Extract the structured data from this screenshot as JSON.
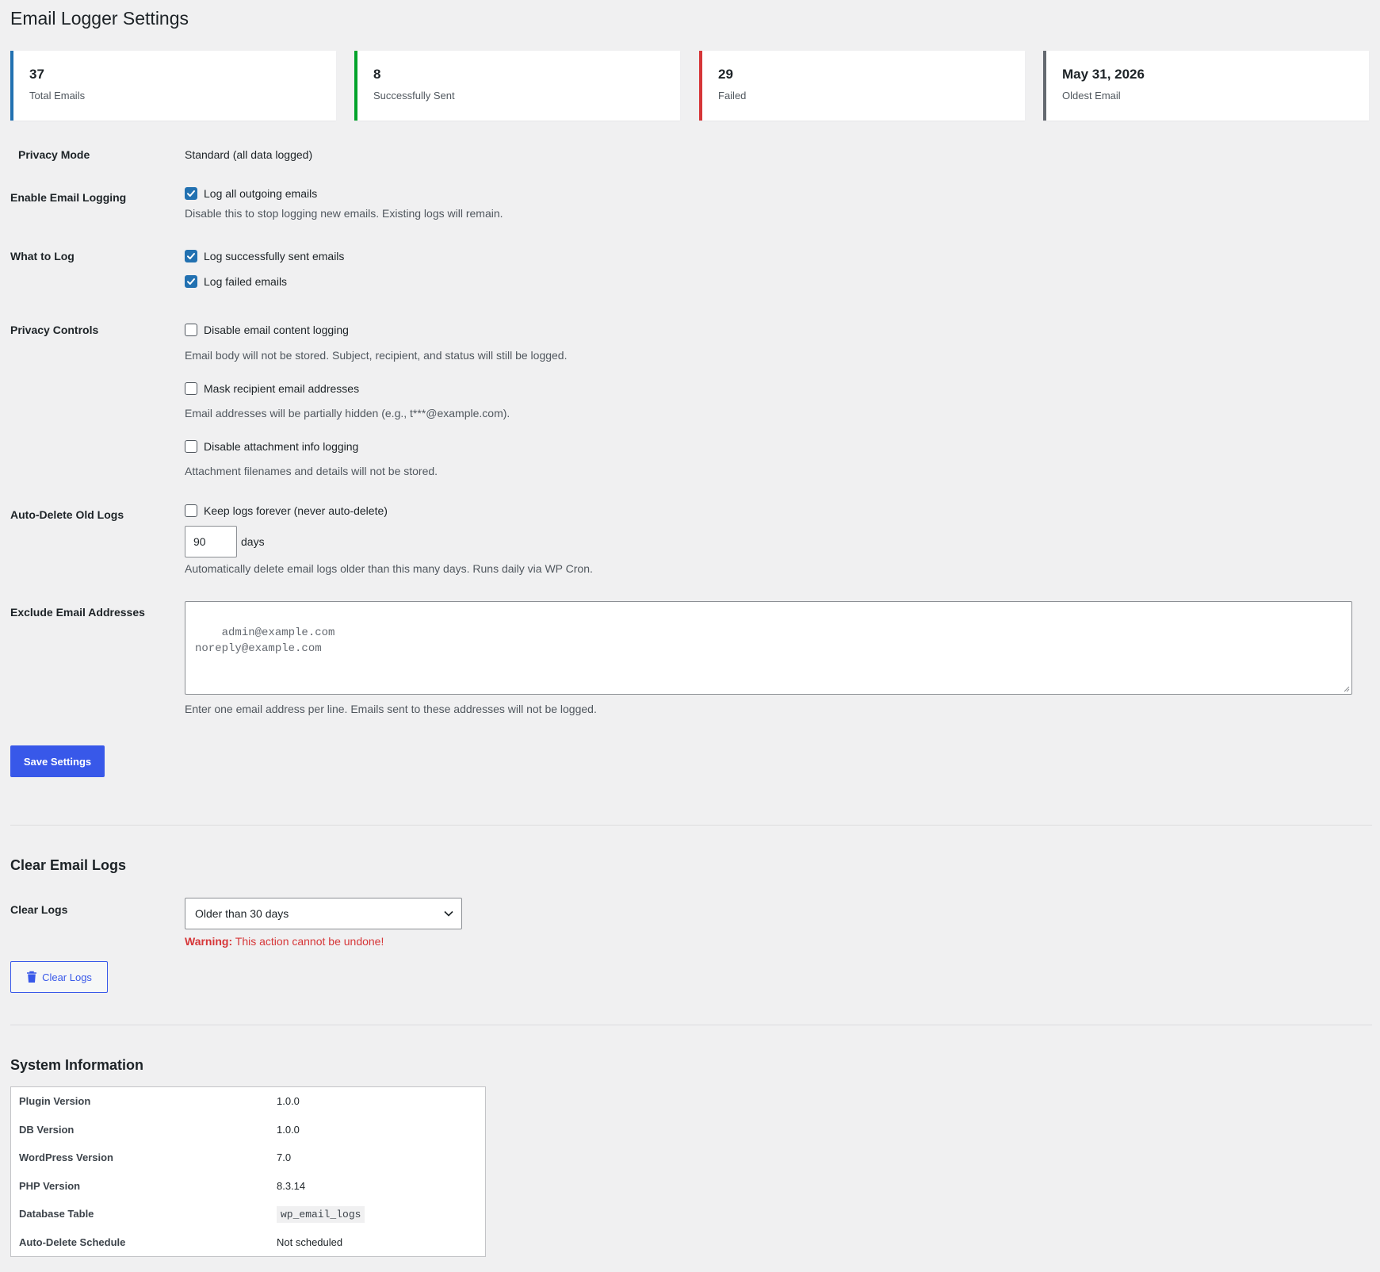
{
  "page": {
    "title": "Email Logger Settings"
  },
  "stats": [
    {
      "value": "37",
      "label": "Total Emails",
      "color": "#2271b1"
    },
    {
      "value": "8",
      "label": "Successfully Sent",
      "color": "#00a32a"
    },
    {
      "value": "29",
      "label": "Failed",
      "color": "#d63638"
    },
    {
      "value": "May 31, 2026",
      "label": "Oldest Email",
      "color": "#646970"
    }
  ],
  "settings": {
    "privacy_mode": {
      "label": "Privacy Mode",
      "value": "Standard (all data logged)"
    },
    "enable_logging": {
      "label": "Enable Email Logging",
      "checkbox_label": "Log all outgoing emails",
      "checked": true,
      "description": "Disable this to stop logging new emails. Existing logs will remain."
    },
    "what_to_log": {
      "label": "What to Log",
      "options": [
        {
          "label": "Log successfully sent emails",
          "checked": true
        },
        {
          "label": "Log failed emails",
          "checked": true
        }
      ]
    },
    "privacy_controls": {
      "label": "Privacy Controls",
      "options": [
        {
          "label": "Disable email content logging",
          "checked": false,
          "description": "Email body will not be stored. Subject, recipient, and status will still be logged."
        },
        {
          "label": "Mask recipient email addresses",
          "checked": false,
          "description": "Email addresses will be partially hidden (e.g., t***@example.com)."
        },
        {
          "label": "Disable attachment info logging",
          "checked": false,
          "description": "Attachment filenames and details will not be stored."
        }
      ]
    },
    "auto_delete": {
      "label": "Auto-Delete Old Logs",
      "checkbox_label": "Keep logs forever (never auto-delete)",
      "checked": false,
      "days_value": "90",
      "days_unit": "days",
      "description": "Automatically delete email logs older than this many days. Runs daily via WP Cron."
    },
    "exclude": {
      "label": "Exclude Email Addresses",
      "placeholder": "admin@example.com\nnoreply@example.com",
      "description": "Enter one email address per line. Emails sent to these addresses will not be logged."
    },
    "save_label": "Save Settings"
  },
  "clear_logs": {
    "heading": "Clear Email Logs",
    "label": "Clear Logs",
    "selected": "Older than 30 days",
    "warning_strong": "Warning:",
    "warning_text": " This action cannot be undone!",
    "button_label": "Clear Logs",
    "button_icon": "trash-icon"
  },
  "system_info": {
    "heading": "System Information",
    "rows": [
      {
        "key": "Plugin Version",
        "value": "1.0.0"
      },
      {
        "key": "DB Version",
        "value": "1.0.0"
      },
      {
        "key": "WordPress Version",
        "value": "7.0"
      },
      {
        "key": "PHP Version",
        "value": "8.3.14"
      },
      {
        "key": "Database Table",
        "value": "wp_email_logs"
      },
      {
        "key": "Auto-Delete Schedule",
        "value": "Not scheduled"
      }
    ]
  }
}
